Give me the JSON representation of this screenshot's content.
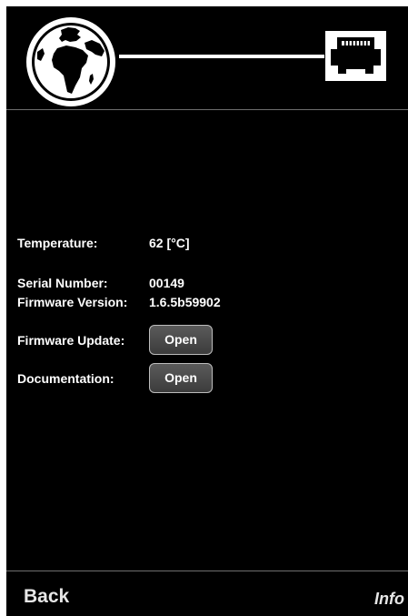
{
  "header": {
    "globe_icon": "globe-icon",
    "ethernet_icon": "ethernet-port-icon",
    "connection": "connected"
  },
  "info": {
    "temperature_label": "Temperature:",
    "temperature_value": "62 [°C]",
    "serial_label": "Serial Number:",
    "serial_value": "00149",
    "firmware_version_label": "Firmware Version:",
    "firmware_version_value": "1.6.5b59902",
    "firmware_update_label": "Firmware Update:",
    "firmware_update_button": "Open",
    "documentation_label": "Documentation:",
    "documentation_button": "Open"
  },
  "footer": {
    "back_label": "Back",
    "page_label": "Info"
  },
  "colors": {
    "background": "#000000",
    "text": "#ffffff",
    "button": "#4a4a4a",
    "divider": "#6e6e6e"
  }
}
